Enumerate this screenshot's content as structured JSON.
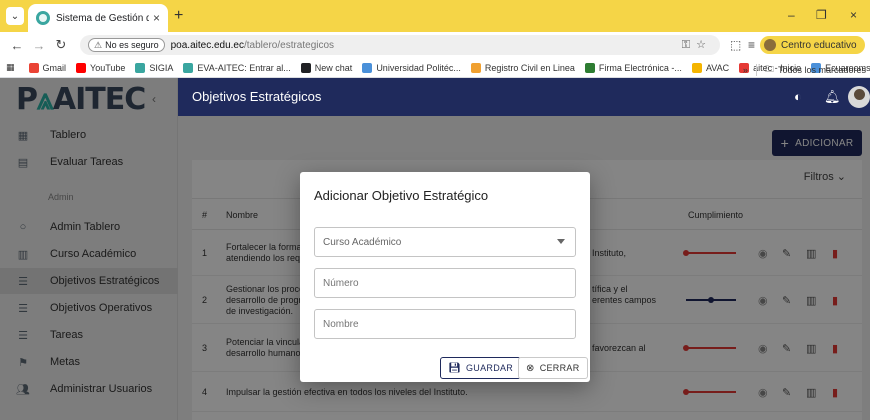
{
  "browser": {
    "tab_title": "Sistema de Gestión del POA",
    "insecure_label": "No es seguro",
    "url_host": "poa.aitec.edu.ec",
    "url_path": "/tablero/estrategicos",
    "profile_label": "Centro educativo",
    "bookmarks": [
      {
        "label": "Gmail",
        "color": "#ea4335"
      },
      {
        "label": "YouTube",
        "color": "#ff0000"
      },
      {
        "label": "SIGIA",
        "color": "#3aa6a0"
      },
      {
        "label": "EVA-AITEC: Entrar al...",
        "color": "#3aa6a0"
      },
      {
        "label": "New chat",
        "color": "#202124"
      },
      {
        "label": "Universidad Politéc...",
        "color": "#4a90d9"
      },
      {
        "label": "Registro Civil en Linea",
        "color": "#f0a030"
      },
      {
        "label": "Firma Electrónica -...",
        "color": "#2e7d32"
      },
      {
        "label": "AVAC",
        "color": "#f4b400"
      },
      {
        "label": "aitec - Inicio",
        "color": "#e53935"
      },
      {
        "label": "Ecuarooms",
        "color": "#4a90d9"
      }
    ],
    "bookmarks_folder": "Todos los marcadores"
  },
  "app": {
    "logo_left": "P",
    "logo_right": "AITEC",
    "page_title": "Objetivos Estratégicos",
    "sidebar": {
      "items_top": [
        {
          "label": "Tablero",
          "icon": "dashboard-icon"
        },
        {
          "label": "Evaluar Tareas",
          "icon": "clipboard-icon"
        }
      ],
      "section_admin": "Admin",
      "items_admin": [
        {
          "label": "Admin Tablero",
          "icon": "circle-icon"
        },
        {
          "label": "Curso Académico",
          "icon": "book-icon"
        },
        {
          "label": "Objetivos Estratégicos",
          "icon": "list-icon",
          "active": true
        },
        {
          "label": "Objetivos Operativos",
          "icon": "list-icon"
        },
        {
          "label": "Tareas",
          "icon": "list-icon"
        },
        {
          "label": "Metas",
          "icon": "flag-icon"
        },
        {
          "label": "Administrar Usuarios",
          "icon": "users-icon"
        }
      ]
    },
    "add_button": "ADICIONAR",
    "filters_label": "Filtros",
    "table": {
      "headers": {
        "num": "#",
        "name": "Nombre",
        "progress": "Cumplimiento"
      },
      "rows": [
        {
          "num": "1",
          "left": "Fortalecer la formaci",
          "left2": "atendiendo los reque",
          "right": "Instituto,",
          "right2": "",
          "progress": 0.0
        },
        {
          "num": "2",
          "left": "Gestionar los proces",
          "left2": "desarrollo de prograr",
          "left3": "de investigación.",
          "right": "tífica y el",
          "right2": "erentes campos",
          "progress": 0.5
        },
        {
          "num": "3",
          "left": "Potenciar la vinculaci",
          "left2": "desarrollo humano in",
          "right": "favorezcan al",
          "right2": "",
          "progress": 0.0
        },
        {
          "num": "4",
          "left": "Impulsar la gestión efectiva en todos los niveles del Instituto.",
          "left2": "",
          "right": "",
          "right2": "",
          "progress": 0.0
        }
      ]
    }
  },
  "modal": {
    "title": "Adicionar Objetivo Estratégico",
    "field_course": "Curso Académico",
    "field_number": "Número",
    "field_name": "Nombre",
    "save_label": "GUARDAR",
    "close_label": "CERRAR"
  }
}
